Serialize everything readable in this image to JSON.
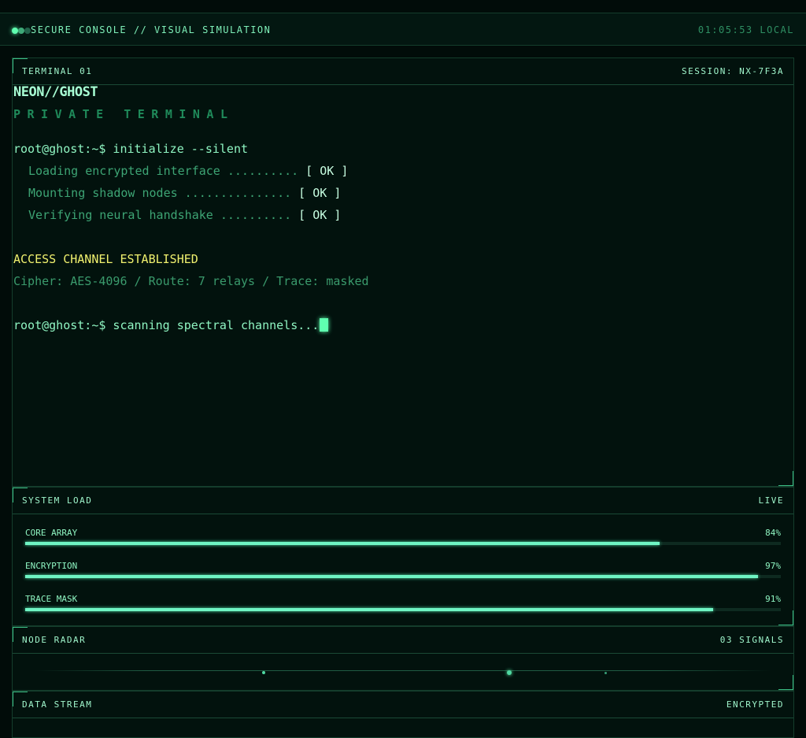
{
  "topbar": {
    "title": "SECURE CONSOLE // VISUAL SIMULATION",
    "clock": "01:05:53 LOCAL"
  },
  "terminal": {
    "header_left": "TERMINAL 01",
    "header_right": "SESSION: NX-7F3A",
    "title": "NEON//GHOST",
    "subtitle": "PRIVATE TERMINAL",
    "cmd1": "root@ghost:~$ initialize --silent",
    "checks": [
      {
        "text": "Loading encrypted interface ..........",
        "status": "[ OK ]"
      },
      {
        "text": "Mounting shadow nodes ...............",
        "status": "[ OK ]"
      },
      {
        "text": "Verifying neural handshake ..........",
        "status": "[ OK ]"
      }
    ],
    "access": "ACCESS CHANNEL ESTABLISHED",
    "cipher": "Cipher: AES-4096 / Route: 7 relays / Trace: masked",
    "cmd2": "root@ghost:~$ scanning spectral channels..."
  },
  "system_load": {
    "header_left": "SYSTEM LOAD",
    "header_right": "LIVE",
    "meters": [
      {
        "label": "CORE ARRAY",
        "value": "84%",
        "percent": 84
      },
      {
        "label": "ENCRYPTION",
        "value": "97%",
        "percent": 97
      },
      {
        "label": "TRACE MASK",
        "value": "91%",
        "percent": 91
      }
    ]
  },
  "radar": {
    "header_left": "NODE RADAR",
    "header_right": "03 SIGNALS"
  },
  "stream": {
    "header_left": "DATA STREAM",
    "header_right": "ENCRYPTED"
  }
}
